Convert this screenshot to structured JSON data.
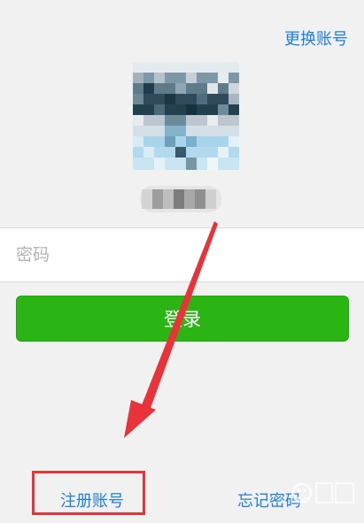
{
  "header": {
    "switch_account_label": "更换账号"
  },
  "password": {
    "placeholder": "密码"
  },
  "login": {
    "label": "登录"
  },
  "footer": {
    "register_label": "注册账号",
    "forgot_label": "忘记密码"
  },
  "colors": {
    "link": "#1e7fe0",
    "primary_button": "#2bb514",
    "annotation": "#e8333a"
  },
  "annotations": {
    "arrow_icon": "red-arrow-icon",
    "highlight": "register-highlight-box"
  }
}
